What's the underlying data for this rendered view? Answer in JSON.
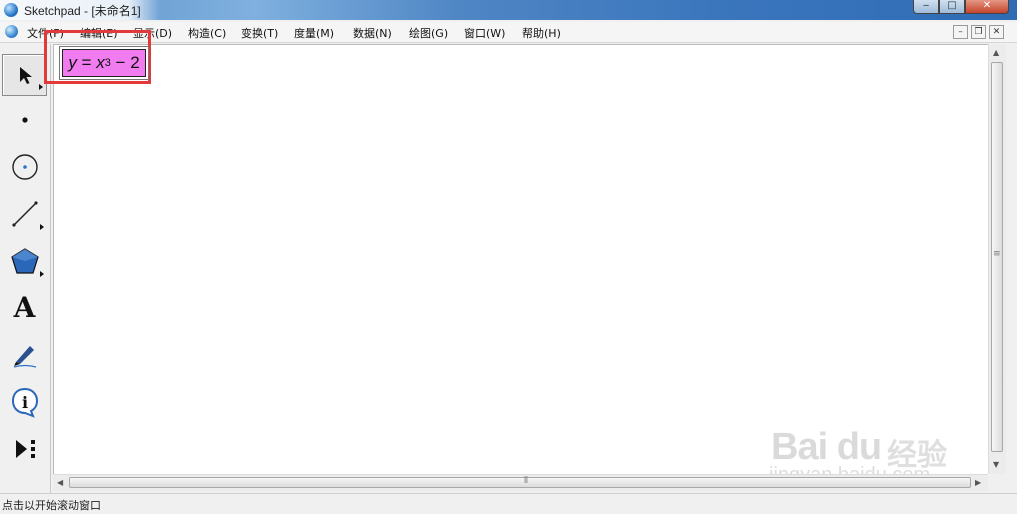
{
  "window": {
    "title": "Sketchpad  - [未命名1]",
    "controls": {
      "minimize": "‒",
      "maximize": "□",
      "close": "✕"
    }
  },
  "menu": {
    "items": [
      "文件(F)",
      "编辑(E)",
      "显示(D)",
      "构造(C)",
      "变换(T)",
      "度量(M)",
      "数据(N)",
      "绘图(G)",
      "窗口(W)",
      "帮助(H)"
    ],
    "mdi_controls": {
      "minimize": "–",
      "restore": "❐",
      "close": "✕"
    }
  },
  "toolbox": {
    "tools": [
      {
        "icon": "arrow-select-icon",
        "selected": true
      },
      {
        "icon": "point-icon"
      },
      {
        "icon": "compass-circle-icon"
      },
      {
        "icon": "straightedge-line-icon"
      },
      {
        "icon": "polygon-icon"
      },
      {
        "icon": "text-tool-icon",
        "glyph": "A"
      },
      {
        "icon": "marker-pen-icon"
      },
      {
        "icon": "information-icon",
        "glyph": "i"
      },
      {
        "icon": "custom-tool-icon"
      }
    ]
  },
  "canvas": {
    "equation": {
      "lhs": "y",
      "equals": " = ",
      "base": "x",
      "exponent": "3",
      "tail": " − 2"
    },
    "highlight_color": "#e23a3a",
    "equation_fill": "#f07cf0"
  },
  "scrollbars": {
    "up": "▲",
    "down": "▼",
    "left": "◀",
    "right": "▶",
    "grip": "≡",
    "hgrip": "⦀"
  },
  "status": {
    "text": "点击以开始滚动窗口"
  },
  "watermark": {
    "logo": "Bai du",
    "cn": "经验",
    "url": "jingyan.baidu.com"
  }
}
